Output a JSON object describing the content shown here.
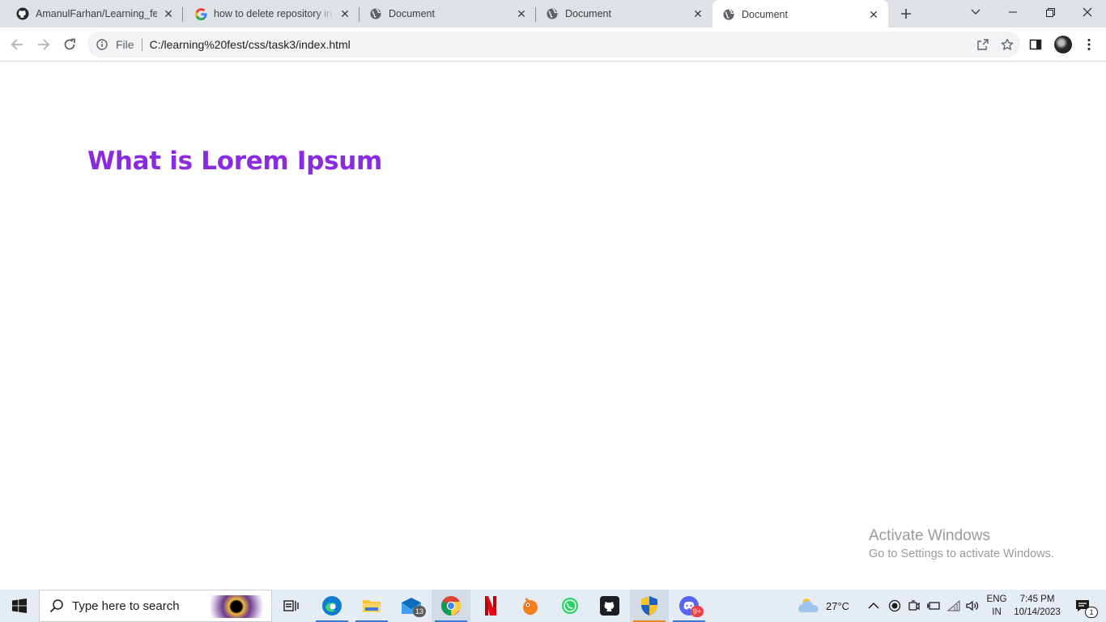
{
  "tabs": [
    {
      "title": "AmanulFarhan/Learning_fest",
      "icon": "github-icon"
    },
    {
      "title": "how to delete repository in git",
      "icon": "google-icon"
    },
    {
      "title": "Document",
      "icon": "globe-icon"
    },
    {
      "title": "Document",
      "icon": "globe-icon"
    },
    {
      "title": "Document",
      "icon": "globe-icon",
      "active": true
    }
  ],
  "toolbar": {
    "scheme_label": "File",
    "url": "C:/learning%20fest/css/task3/index.html"
  },
  "page": {
    "heading": "What is Lorem Ipsum",
    "heading_color": "#8a2be2"
  },
  "watermark": {
    "line1": "Activate Windows",
    "line2": "Go to Settings to activate Windows."
  },
  "taskbar": {
    "search_placeholder": "Type here to search",
    "mail_badge": "13",
    "discord_badge": "9+",
    "weather_temp": "27°C",
    "lang_line1": "ENG",
    "lang_line2": "IN",
    "time": "7:45 PM",
    "date": "10/14/2023",
    "notification_count": "1"
  }
}
